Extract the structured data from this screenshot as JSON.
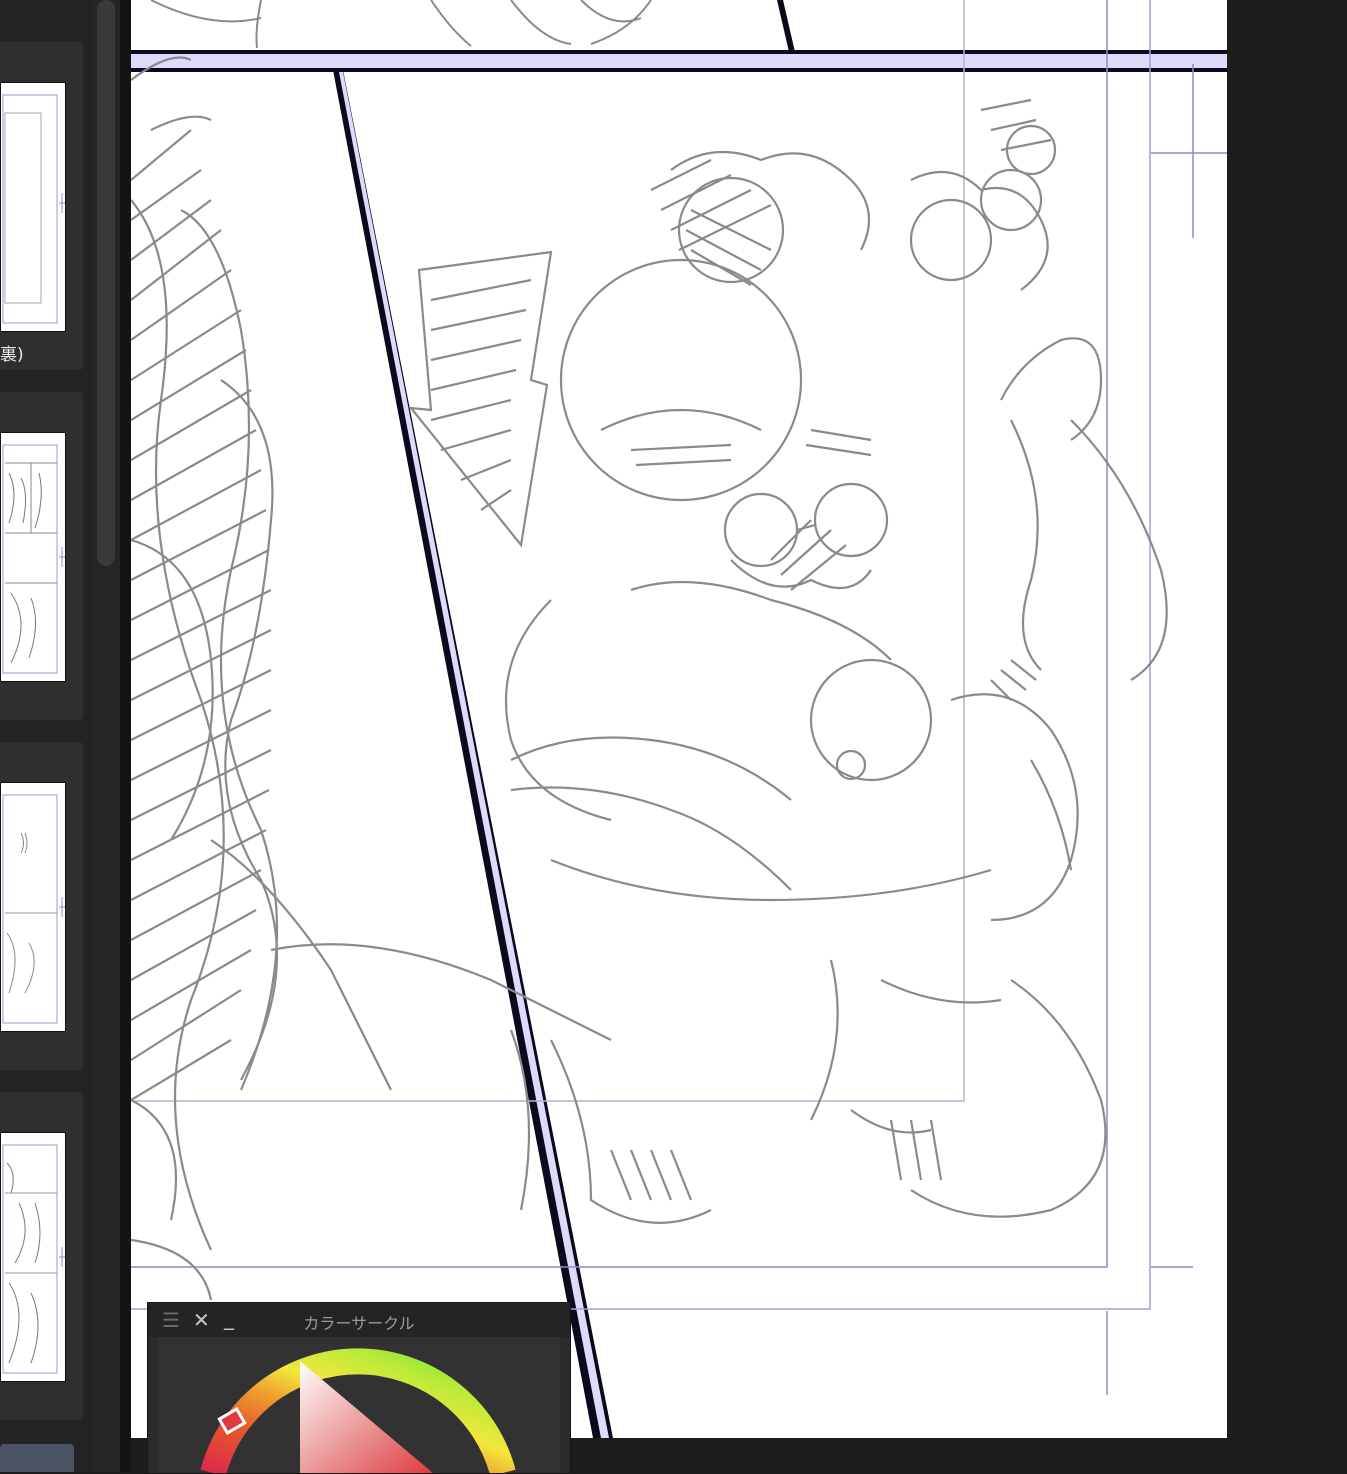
{
  "page_panel": {
    "pages": [
      {
        "label": "裏)"
      },
      {
        "label": ""
      },
      {
        "label": ""
      },
      {
        "label": ""
      }
    ]
  },
  "color_panel": {
    "title": "カラーサークル",
    "menu_icon": "hamburger-icon",
    "close_icon": "close-icon",
    "minimize_icon": "minimize-icon",
    "selected_hue_color": "#e03a3f"
  },
  "canvas": {
    "background": "#ffffff",
    "gutter_color": "#dcdcfa",
    "border_color": "#0a0a1e",
    "guide_color": "#8c8cc8"
  }
}
